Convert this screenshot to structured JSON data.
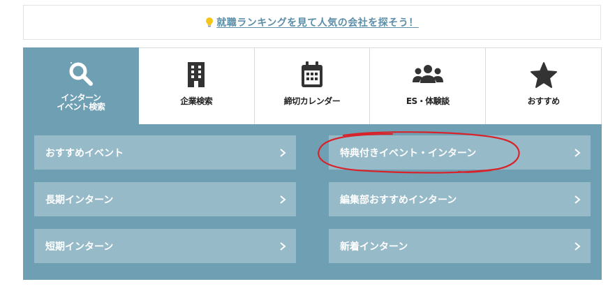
{
  "banner": {
    "text": "就職ランキングを見て人気の会社を探そう！",
    "icon": "lightbulb-icon"
  },
  "tabs": [
    {
      "label": "インターン\nイベント検索",
      "icon": "search-icon",
      "active": true
    },
    {
      "label": "企業検索",
      "icon": "building-icon",
      "active": false
    },
    {
      "label": "締切カレンダー",
      "icon": "calendar-icon",
      "active": false
    },
    {
      "label": "ES・体験談",
      "icon": "users-icon",
      "active": false
    },
    {
      "label": "おすすめ",
      "icon": "star-icon",
      "active": false
    }
  ],
  "links": [
    {
      "label": "おすすめイベント"
    },
    {
      "label": "特典付きイベント・インターン"
    },
    {
      "label": "長期インターン"
    },
    {
      "label": "編集部おすすめインターン"
    },
    {
      "label": "短期インターン"
    },
    {
      "label": "新着インターン"
    }
  ],
  "colors": {
    "accent": "#6e9fb3",
    "link_bg": "#97bac8",
    "banner_link": "#5c8ea8",
    "annotation": "#d8232a"
  }
}
